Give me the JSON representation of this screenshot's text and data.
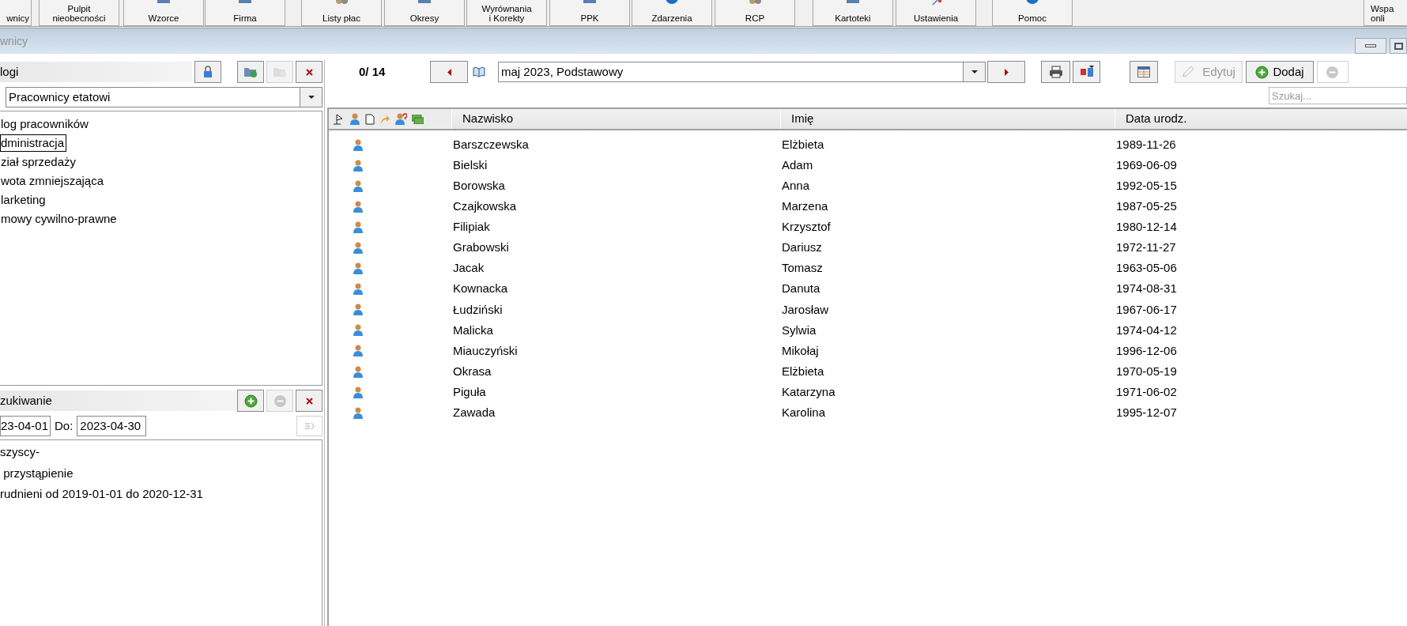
{
  "toolbar": [
    {
      "label": "wnicy"
    },
    {
      "label": "Pulpit\nnieobecności"
    },
    {
      "label": "Wzorce"
    },
    {
      "label": "Firma"
    },
    {
      "label": "Listy płac"
    },
    {
      "label": "Okresy"
    },
    {
      "label": "Wyrównania\ni Korekty"
    },
    {
      "label": "PPK"
    },
    {
      "label": "Zdarzenia"
    },
    {
      "label": "RCP"
    },
    {
      "label": "Kartoteki"
    },
    {
      "label": "Ustawienia"
    },
    {
      "label": "Pomoc"
    },
    {
      "label": "Wspa\nonli"
    }
  ],
  "window": {
    "title": "wnicy"
  },
  "catalogs": {
    "title": "logi",
    "buttons": [
      {
        "kind": "lock",
        "disabled": false
      },
      {
        "kind": "folder-add",
        "disabled": false
      },
      {
        "kind": "folder-remove",
        "disabled": true
      },
      {
        "kind": "close",
        "disabled": false
      }
    ],
    "combo": "Pracownicy etatowi",
    "items": [
      {
        "label": "log pracowników",
        "selected": false
      },
      {
        "label": "dministracja",
        "selected": true
      },
      {
        "label": "ział sprzedaży",
        "selected": false
      },
      {
        "label": "wota zmniejszająca",
        "selected": false
      },
      {
        "label": "larketing",
        "selected": false
      },
      {
        "label": "mowy cywilno-prawne",
        "selected": false
      }
    ]
  },
  "search_panel": {
    "title": "zukiwanie",
    "buttons": [
      {
        "kind": "add",
        "disabled": false
      },
      {
        "kind": "remove",
        "disabled": true
      },
      {
        "kind": "close",
        "disabled": false
      }
    ],
    "from": "23-04-01",
    "to_label": "Do:",
    "to": "2023-04-30",
    "apply_disabled": true,
    "items": [
      {
        "label": "szyscy-"
      },
      {
        "label": " przystąpienie"
      },
      {
        "label": "rudnieni od 2019-01-01 do 2020-12-31"
      }
    ]
  },
  "list_toolbar": {
    "counter": "0/ 14",
    "period": "maj 2023, Podstawowy",
    "edit": {
      "label": "Edytuj",
      "disabled": true
    },
    "add": {
      "label": "Dodaj",
      "disabled": false
    },
    "remove_disabled": true,
    "search_placeholder": "Szukaj..."
  },
  "table": {
    "columns": [
      "Nazwisko",
      "Imię",
      "Data urodz."
    ],
    "rows": [
      [
        "Barszczewska",
        "Elżbieta",
        "1989-11-26"
      ],
      [
        "Bielski",
        "Adam",
        "1969-06-09"
      ],
      [
        "Borowska",
        "Anna",
        "1992-05-15"
      ],
      [
        "Czajkowska",
        "Marzena",
        "1987-05-25"
      ],
      [
        "Filipiak",
        "Krzysztof",
        "1980-12-14"
      ],
      [
        "Grabowski",
        "Dariusz",
        "1972-11-27"
      ],
      [
        "Jacak",
        "Tomasz",
        "1963-05-06"
      ],
      [
        "Kownacka",
        "Danuta",
        "1974-08-31"
      ],
      [
        "Łudziński",
        "Jarosław",
        "1967-06-17"
      ],
      [
        "Malicka",
        "Sylwia",
        "1974-04-12"
      ],
      [
        "Miauczyński",
        "Mikołaj",
        "1996-12-06"
      ],
      [
        "Okrasa",
        "Elżbieta",
        "1970-05-19"
      ],
      [
        "Piguła",
        "Katarzyna",
        "1971-06-02"
      ],
      [
        "Zawada",
        "Karolina",
        "1995-12-07"
      ]
    ]
  }
}
